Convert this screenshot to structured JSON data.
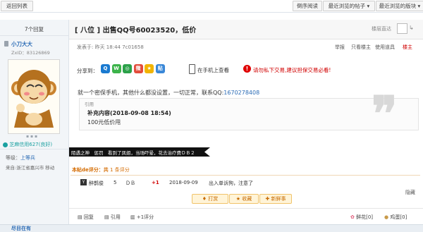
{
  "toolbar": {
    "back": "返回列表",
    "reverse": "倒序阅读",
    "recent_post": "最近浏览的帖子",
    "recent_board": "最近浏览的版块"
  },
  "thread": {
    "reply_count": "7个回复",
    "title": "[ 八位 ] 出售QQ号60023520，低价",
    "floor_jump": "楼层直达"
  },
  "author": {
    "name": "小刀大大",
    "zxid": "ZxID：83126869",
    "credit": "芝麻信用627(良好)",
    "level_label": "等级：",
    "level": "上等兵",
    "from": "来自:浙江省嘉兴市 移动"
  },
  "post": {
    "posted": "发表于: 昨天 18:44 7c01658",
    "actions": [
      "举报",
      "只看楼主",
      "使用道具"
    ],
    "floor": "楼主",
    "share_label": "分享到：",
    "phone_view": "在手机上查看",
    "warning": "请勿私下交易,建议担保交易必看!",
    "body": "就一个密保手机，其他什么都没设置，一切正常，联系QQ:",
    "qq_link": "1670278408",
    "quote_label": "引用",
    "quote_title": "补充内容(2018-09-08 18:54)",
    "quote_text": "100元低价甩"
  },
  "signature": "陌遇之神　惩罚　看到了凤姐，当场吓晕，花去治疗费ＤＢ２",
  "rating": {
    "title": "本帖de评分：共",
    "count": "1",
    "suffix": "条评分",
    "user": "醉鹊俊",
    "col1": "5",
    "col2": "ＤＢ",
    "score": "+1",
    "date": "2018-09-09",
    "comment": "出入单诉狗，注意了",
    "hide": "隐藏"
  },
  "buttons": {
    "tip": "打赏",
    "favorite": "收藏",
    "new": "新鲜事"
  },
  "footer": {
    "reply": "回复",
    "quote": "引用",
    "rate": "+1评分",
    "flower": "鲜花[0]",
    "egg": "鸡蛋[0]",
    "next_author": "尽目在有"
  },
  "colors": {
    "accent_blue": "#2a6bb5",
    "warning_red": "#d00000",
    "rating_orange": "#d46b00",
    "credit_teal": "#1aa0a0"
  }
}
